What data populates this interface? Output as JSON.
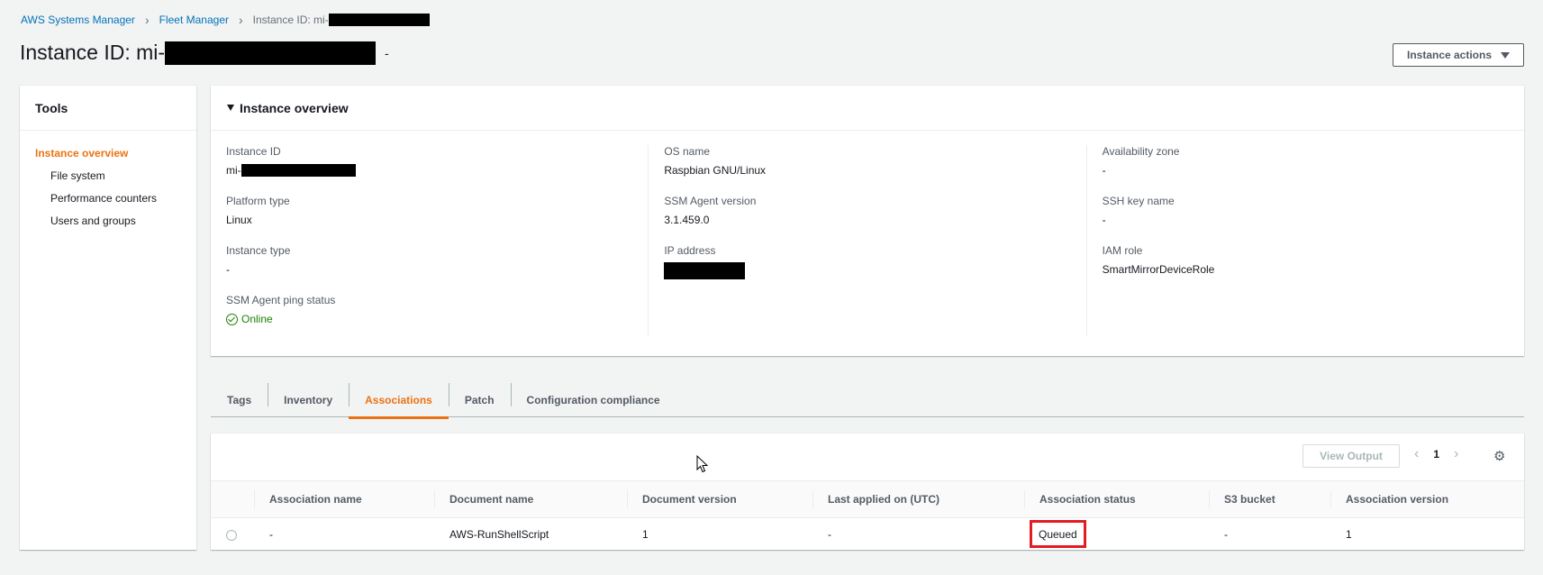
{
  "breadcrumb": {
    "items": [
      "AWS Systems Manager",
      "Fleet Manager"
    ],
    "current": "Instance ID: mi-"
  },
  "page": {
    "title": "Instance ID: mi-",
    "title_suffix": "-",
    "actions_label": "Instance actions"
  },
  "tools": {
    "title": "Tools",
    "items": [
      "Instance overview",
      "File system",
      "Performance counters",
      "Users and groups"
    ]
  },
  "overview": {
    "title": "Instance overview",
    "col1": {
      "instance_id_label": "Instance ID",
      "instance_id_value": "mi-",
      "platform_type_label": "Platform type",
      "platform_type_value": "Linux",
      "instance_type_label": "Instance type",
      "instance_type_value": "-",
      "ping_status_label": "SSM Agent ping status",
      "ping_status_value": "Online"
    },
    "col2": {
      "os_name_label": "OS name",
      "os_name_value": "Raspbian GNU/Linux",
      "agent_version_label": "SSM Agent version",
      "agent_version_value": "3.1.459.0",
      "ip_label": "IP address"
    },
    "col3": {
      "az_label": "Availability zone",
      "az_value": "-",
      "ssh_key_label": "SSH key name",
      "ssh_key_value": "-",
      "iam_role_label": "IAM role",
      "iam_role_value": "SmartMirrorDeviceRole"
    }
  },
  "tabs": [
    "Tags",
    "Inventory",
    "Associations",
    "Patch",
    "Configuration compliance"
  ],
  "associations": {
    "view_output_label": "View Output",
    "page_number": "1",
    "columns": [
      "Association name",
      "Document name",
      "Document version",
      "Last applied on (UTC)",
      "Association status",
      "S3 bucket",
      "Association version"
    ],
    "rows": [
      [
        "-",
        "AWS-RunShellScript",
        "1",
        "-",
        "Queued",
        "-",
        "1"
      ]
    ]
  },
  "colors": {
    "accent": "#ec7211",
    "link": "#0073bb",
    "online": "#1d8102",
    "highlight": "#e31b23"
  }
}
